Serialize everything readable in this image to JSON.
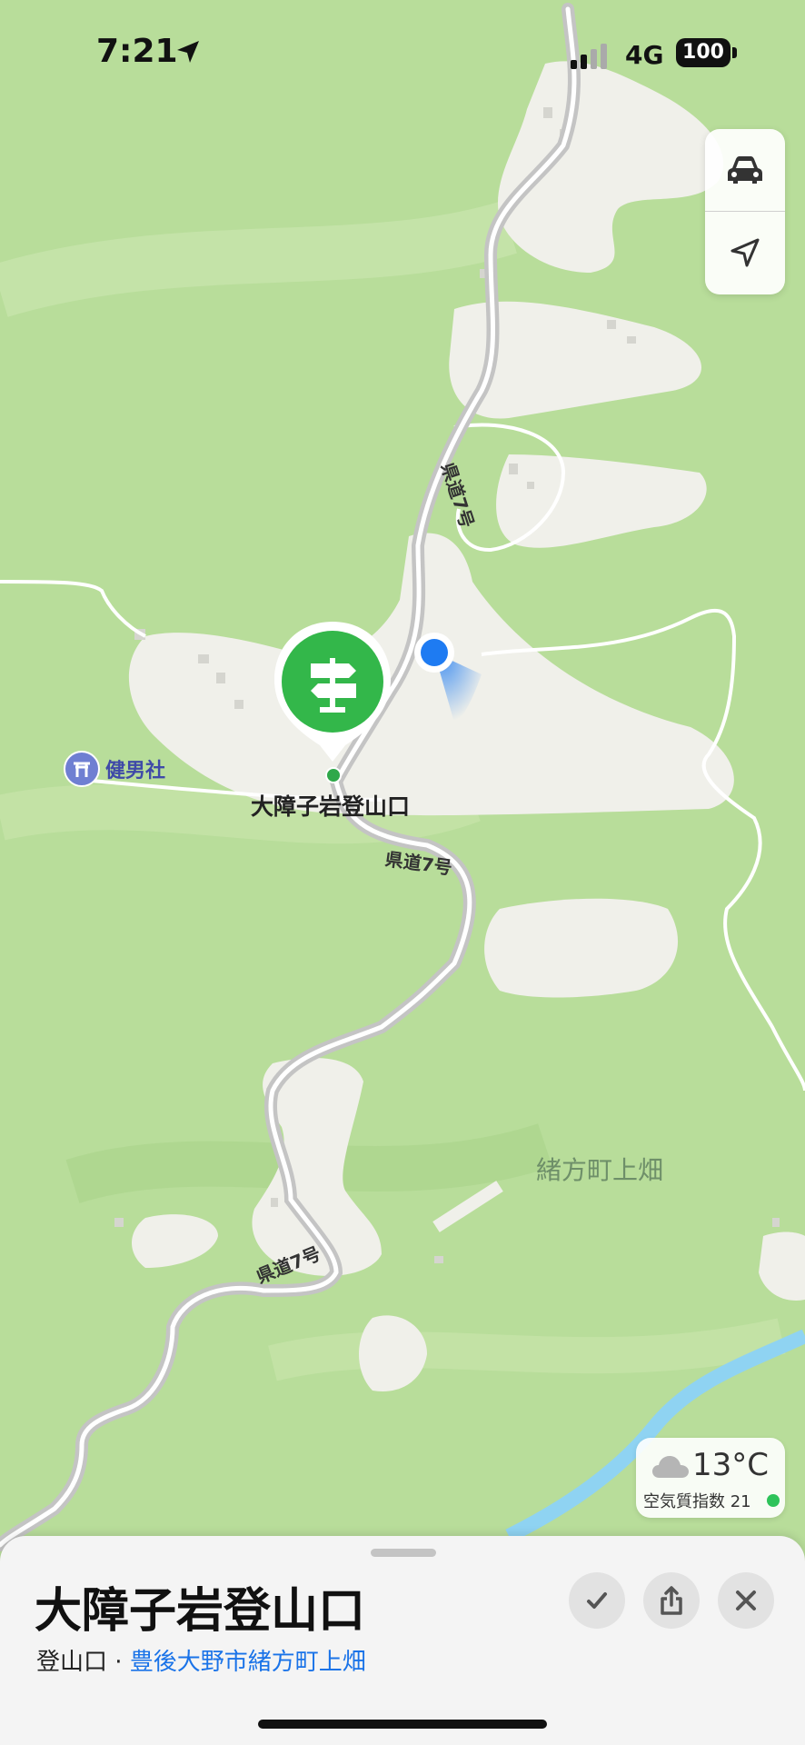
{
  "status_bar": {
    "time": "7:21",
    "network": "4G",
    "battery": "100"
  },
  "map": {
    "pin_label": "大障子岩登山口",
    "shrine_label": "健男社",
    "area_label": "緒方町上畑",
    "road_labels": [
      "県道7号",
      "県道7号",
      "県道7号"
    ],
    "pin_icon": "signpost-icon",
    "colors": {
      "terrain": "#b8dd9a",
      "pin_green": "#34c759",
      "location_blue": "#1e7bf2",
      "river": "#8fd3f2"
    }
  },
  "controls": {
    "drive_icon": "car-icon",
    "locate_icon": "location-arrow-icon"
  },
  "weather": {
    "temperature": "13°C",
    "aqi_label": "空気質指数 21",
    "icon": "cloud-icon"
  },
  "place_sheet": {
    "title": "大障子岩登山口",
    "category": "登山口 · ",
    "locality": "豊後大野市緒方町上畑",
    "buttons": [
      "checkmark-icon",
      "share-icon",
      "close-icon"
    ]
  }
}
